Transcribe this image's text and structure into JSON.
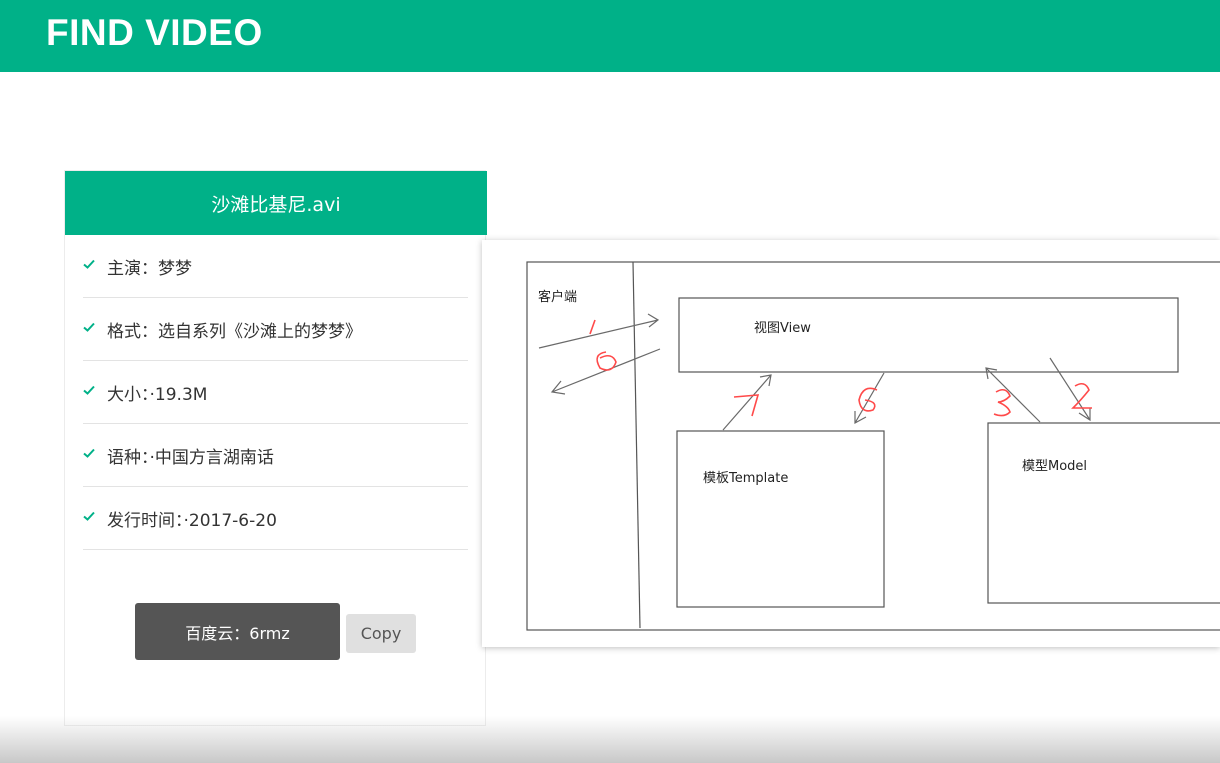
{
  "header": {
    "brand": "FIND VIDEO"
  },
  "card": {
    "title": "沙滩比基尼.avi",
    "items": [
      {
        "label": "主演：梦梦"
      },
      {
        "label": "格式：选自系列《沙滩上的梦梦》"
      },
      {
        "label": "大小：·19.3M"
      },
      {
        "label": "语种：·中国方言湖南话"
      },
      {
        "label": "发行时间：·2017-6-20"
      }
    ],
    "code_label": "百度云：6rmz",
    "copy_label": "Copy"
  },
  "diagram": {
    "client_label": "客户端",
    "view_label": "视图View",
    "template_label": "模板Template",
    "model_label": "模型Model",
    "step_labels": [
      "1",
      "8",
      "7",
      "6",
      "3",
      "2"
    ]
  },
  "colors": {
    "accent": "#00b188",
    "button_dark": "#555555",
    "annotation": "#ff4a4a"
  }
}
